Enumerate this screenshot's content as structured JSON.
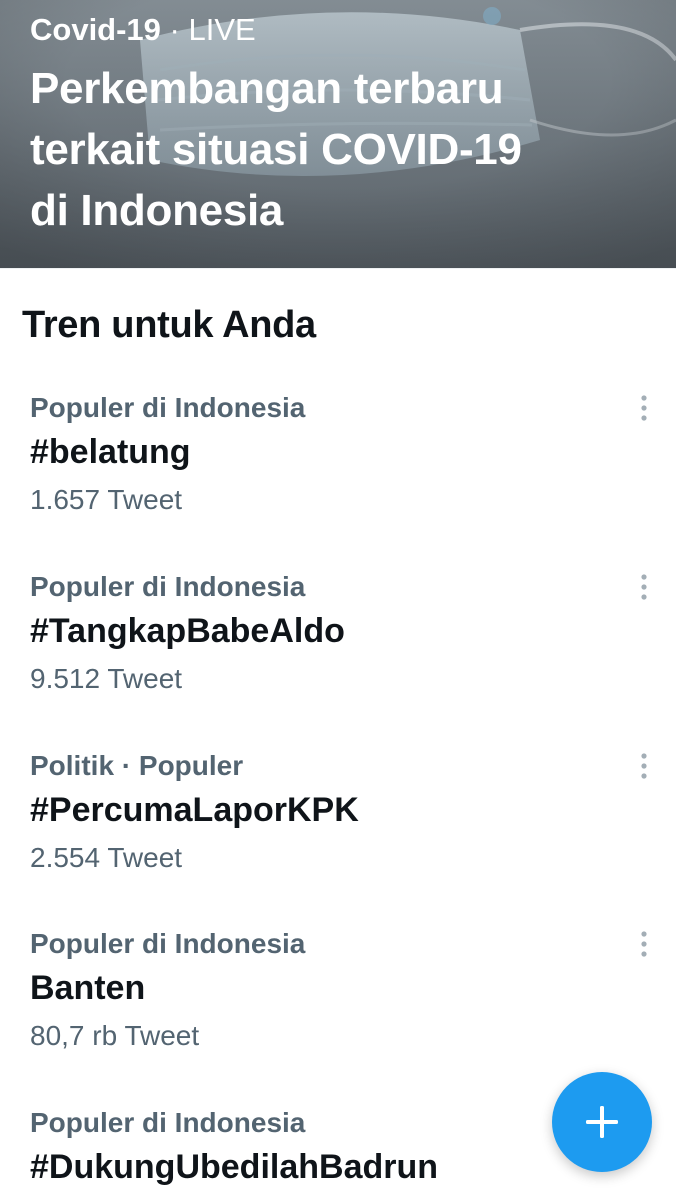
{
  "hero": {
    "topic": "Covid-19",
    "separator": " · ",
    "live_label": "LIVE",
    "title_lines": [
      "Perkembangan terbaru",
      "terkait situasi COVID-19",
      "di Indonesia"
    ]
  },
  "section": {
    "title": "Tren untuk Anda"
  },
  "trends": [
    {
      "context": "Populer di Indonesia",
      "name": "#belatung",
      "count": "1.657 Tweet",
      "has_more": true
    },
    {
      "context": "Populer di Indonesia",
      "name": "#TangkapBabeAldo",
      "count": "9.512 Tweet",
      "has_more": true
    },
    {
      "context": "Politik · Populer",
      "name": "#PercumaLaporKPK",
      "count": "2.554 Tweet",
      "has_more": true
    },
    {
      "context": "Populer di Indonesia",
      "name": "Banten",
      "count": "80,7 rb Tweet",
      "has_more": true
    },
    {
      "context": "Populer di Indonesia",
      "name": "#DukungUbedilahBadrun",
      "count": "",
      "has_more": false
    }
  ],
  "icons": {
    "more": "more-vertical-icon",
    "compose": "plus-icon"
  },
  "colors": {
    "accent": "#1d9bf0",
    "text_primary": "#0f1419",
    "text_secondary": "#536471"
  }
}
